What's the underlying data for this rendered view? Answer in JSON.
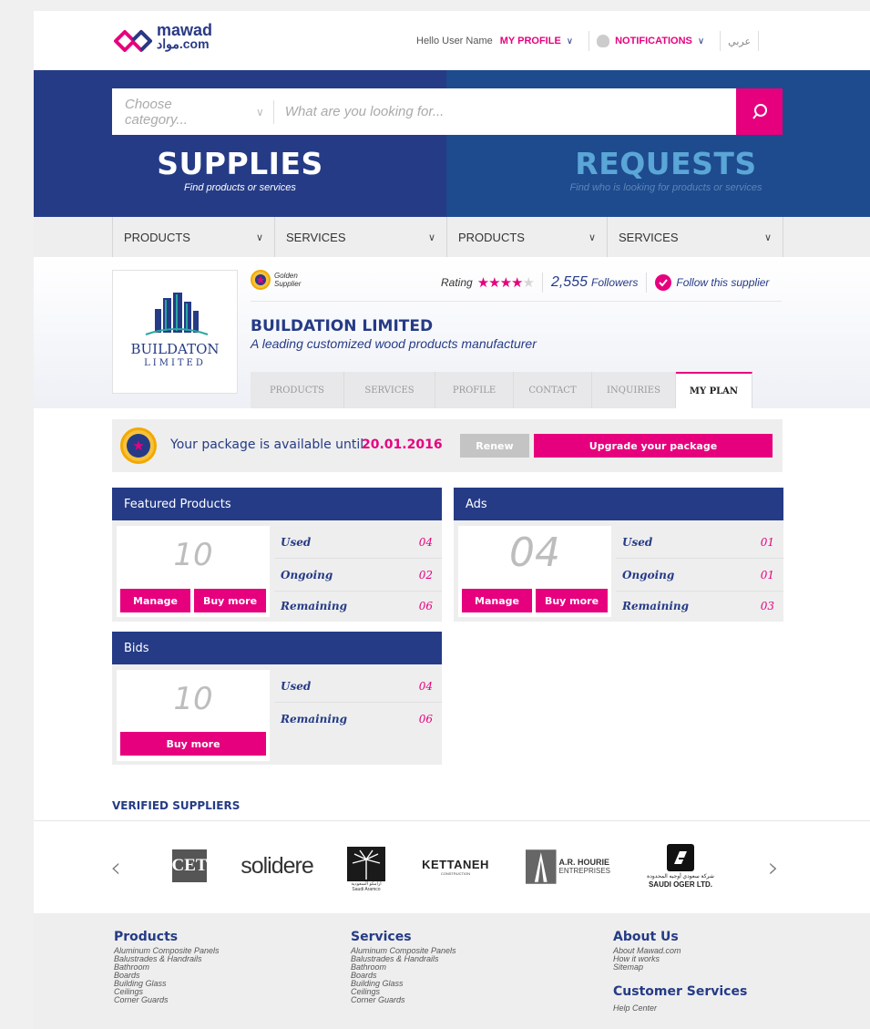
{
  "brand": {
    "name_line1": "mawad",
    "name_line2": "مواد.com"
  },
  "topnav": {
    "hello": "Hello User Name",
    "my_profile": "MY PROFILE",
    "notifications": "NOTIFICATIONS",
    "language": "عربي"
  },
  "search": {
    "category_placeholder": "Choose category...",
    "query_placeholder": "What are you looking for..."
  },
  "hero": {
    "supplies_title": "SUPPLIES",
    "supplies_sub": "Find products or services",
    "requests_title": "REQUESTS",
    "requests_sub": "Find who is looking for products or services"
  },
  "subnav": [
    {
      "label": "PRODUCTS"
    },
    {
      "label": "SERVICES"
    },
    {
      "label": "PRODUCTS"
    },
    {
      "label": "SERVICES"
    }
  ],
  "supplier": {
    "badge": "Golden\nSupplier",
    "logo_line1": "BUILDATON",
    "logo_line2": "LIMITED",
    "name": "BUILDATION LIMITED",
    "description": "A leading customized wood products manufacturer",
    "rating_label": "Rating",
    "rating_value": 4,
    "rating_max": 5,
    "followers_count": "2,555",
    "followers_label": "Followers",
    "follow_label": "Follow this supplier"
  },
  "profile_tabs": [
    {
      "label": "PRODUCTS",
      "active": false
    },
    {
      "label": "SERVICES",
      "active": false
    },
    {
      "label": "PROFILE",
      "active": false
    },
    {
      "label": "CONTACT",
      "active": false
    },
    {
      "label": "INQUIRIES",
      "active": false
    },
    {
      "label": "MY PLAN",
      "active": true
    }
  ],
  "package": {
    "message": "Your package is available until",
    "date": "20.01.2016",
    "renew": "Renew",
    "upgrade": "Upgrade your package"
  },
  "panels": {
    "featured": {
      "title": "Featured Products",
      "total": "10",
      "manage": "Manage",
      "buy_more": "Buy more",
      "stats": [
        {
          "label": "Used",
          "value": "04"
        },
        {
          "label": "Ongoing",
          "value": "02"
        },
        {
          "label": "Remaining",
          "value": "06"
        }
      ]
    },
    "ads": {
      "title": "Ads",
      "total": "04",
      "manage": "Manage",
      "buy_more": "Buy more",
      "stats": [
        {
          "label": "Used",
          "value": "01"
        },
        {
          "label": "Ongoing",
          "value": "01"
        },
        {
          "label": "Remaining",
          "value": "03"
        }
      ]
    },
    "bids": {
      "title": "Bids",
      "total": "10",
      "buy_more": "Buy more",
      "stats": [
        {
          "label": "Used",
          "value": "04"
        },
        {
          "label": "Remaining",
          "value": "06"
        }
      ]
    }
  },
  "verified": {
    "title": "VERIFIED SUPPLIERS",
    "brands": {
      "cet": "CET",
      "solidere": "solidere",
      "aramco": "أرامكو السعودية",
      "aramco_en": "Saudi Aramco",
      "kettaneh": "KETTANEH",
      "kettaneh_sub": "CONSTRUCTION",
      "hourie": "A.R. HOURIE",
      "hourie_sub": "ENTREPRISES",
      "oger_ar": "شركة سعودي أوجيه المحدودة",
      "oger_en": "SAUDI OGER LTD."
    }
  },
  "footer": {
    "products": {
      "title": "Products",
      "items": [
        "Aluminum Composite Panels",
        "Balustrades & Handrails",
        "Bathroom",
        "Boards",
        "Building Glass",
        "Ceilings",
        "Corner Guards"
      ]
    },
    "services": {
      "title": "Services",
      "items": [
        "Aluminum Composite Panels",
        "Balustrades & Handrails",
        "Bathroom",
        "Boards",
        "Building Glass",
        "Ceilings",
        "Corner Guards"
      ]
    },
    "about": {
      "title": "About Us",
      "items": [
        "About Mawad.com",
        "How it works",
        "Sitemap"
      ]
    },
    "customer": {
      "title": "Customer Services",
      "items": [
        "Help Center"
      ]
    }
  },
  "colors": {
    "brand_blue": "#253b86",
    "accent_pink": "#e6007e",
    "gold": "#f6c23e",
    "requests_bg": "#1e4a8e"
  }
}
